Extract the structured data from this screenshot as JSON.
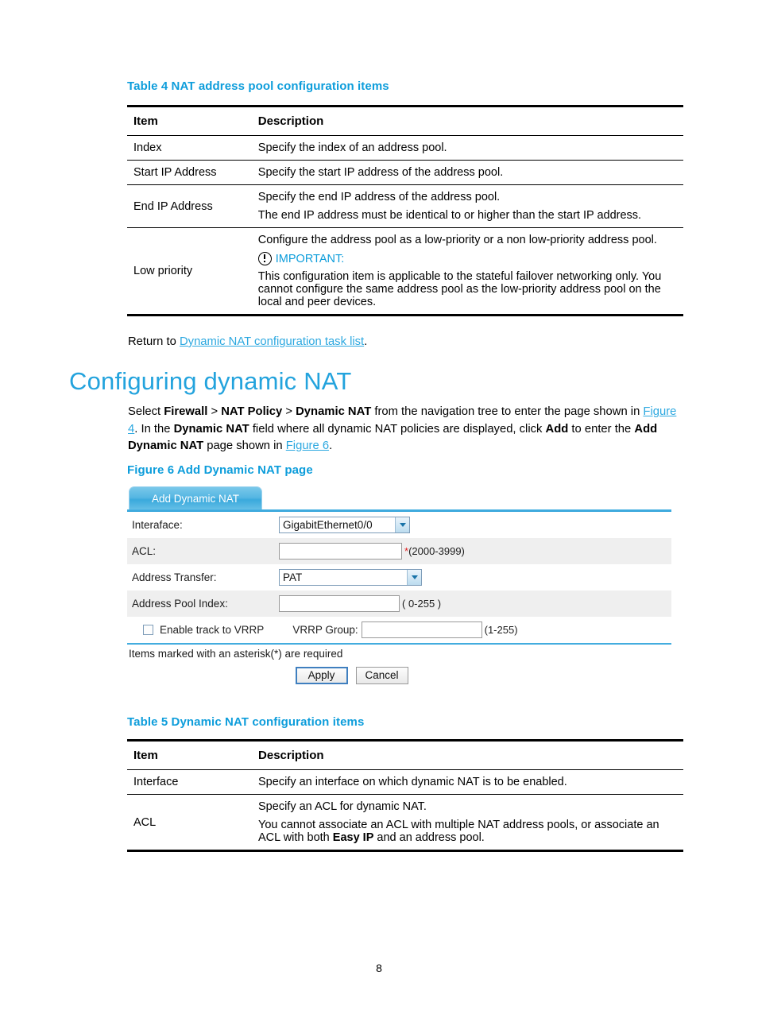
{
  "page": {
    "number": "8"
  },
  "table4": {
    "caption": "Table 4 NAT address pool configuration items",
    "headers": [
      "Item",
      "Description"
    ],
    "rows": [
      {
        "item": "Index",
        "desc": [
          "Specify the index of an address pool."
        ]
      },
      {
        "item": "Start IP Address",
        "desc": [
          "Specify the start IP address of the address pool."
        ]
      },
      {
        "item": "End IP Address",
        "desc": [
          "Specify the end IP address of the address pool.",
          "The end IP address must be identical to or higher than the start IP address."
        ]
      },
      {
        "item": "Low priority",
        "desc_lead": "Configure the address pool as a low-priority or a non low-priority address pool.",
        "important_label": "IMPORTANT:",
        "desc_tail": "This configuration item is applicable to the stateful failover networking only. You cannot configure the same address pool as the low-priority address pool on the local and peer devices."
      }
    ]
  },
  "return_line": {
    "prefix": "Return to ",
    "link": "Dynamic NAT configuration task list",
    "suffix": "."
  },
  "section": {
    "title": "Configuring dynamic NAT",
    "paragraph": {
      "p1": "Select ",
      "nav1": "Firewall",
      "sep1": " > ",
      "nav2": "NAT Policy",
      "sep2": " > ",
      "nav3": "Dynamic NAT",
      "p2": " from the navigation tree to enter the page shown in ",
      "figure4": "Figure 4",
      "p3": ". In the ",
      "nav4": "Dynamic NAT",
      "p4": " field where all dynamic NAT policies are displayed, click ",
      "addBtn": "Add",
      "p5": " to enter the ",
      "nav5": "Add Dynamic NAT",
      "p6": " page shown in ",
      "figure6": "Figure 6",
      "p7": "."
    }
  },
  "figure6": {
    "caption": "Figure 6 Add Dynamic NAT page"
  },
  "ui": {
    "tab_label": "Add Dynamic NAT",
    "interface": {
      "label": "Interaface:",
      "value": "GigabitEthernet0/0"
    },
    "acl": {
      "label": "ACL:",
      "value": "",
      "star": "*",
      "hint": "(2000-3999)"
    },
    "address_transfer": {
      "label": "Address Transfer:",
      "value": "PAT"
    },
    "address_pool_index": {
      "label": "Address Pool Index:",
      "value": "",
      "hint": "( 0-255 )"
    },
    "vrrp": {
      "checkbox_label": "Enable track to VRRP",
      "group_label": "VRRP Group:",
      "group_value": "",
      "hint": "(1-255)",
      "checked": false
    },
    "note": "Items marked with an asterisk(*) are required",
    "apply_label": "Apply",
    "cancel_label": "Cancel"
  },
  "table5": {
    "caption": "Table 5 Dynamic NAT configuration items",
    "headers": [
      "Item",
      "Description"
    ],
    "rows": [
      {
        "item": "Interface",
        "desc": [
          "Specify an interface on which dynamic NAT is to be enabled."
        ]
      },
      {
        "item": "ACL",
        "desc_lead": "Specify an ACL for dynamic NAT.",
        "desc_tail_a": "You cannot associate an ACL with multiple NAT address pools, or associate an ACL with both ",
        "desc_bold": "Easy IP",
        "desc_tail_b": " and an address pool."
      }
    ]
  },
  "colors": {
    "accent": "#0d9ddb",
    "heading": "#23a3dd",
    "link": "#2ca8e0",
    "required": "#e02020"
  }
}
